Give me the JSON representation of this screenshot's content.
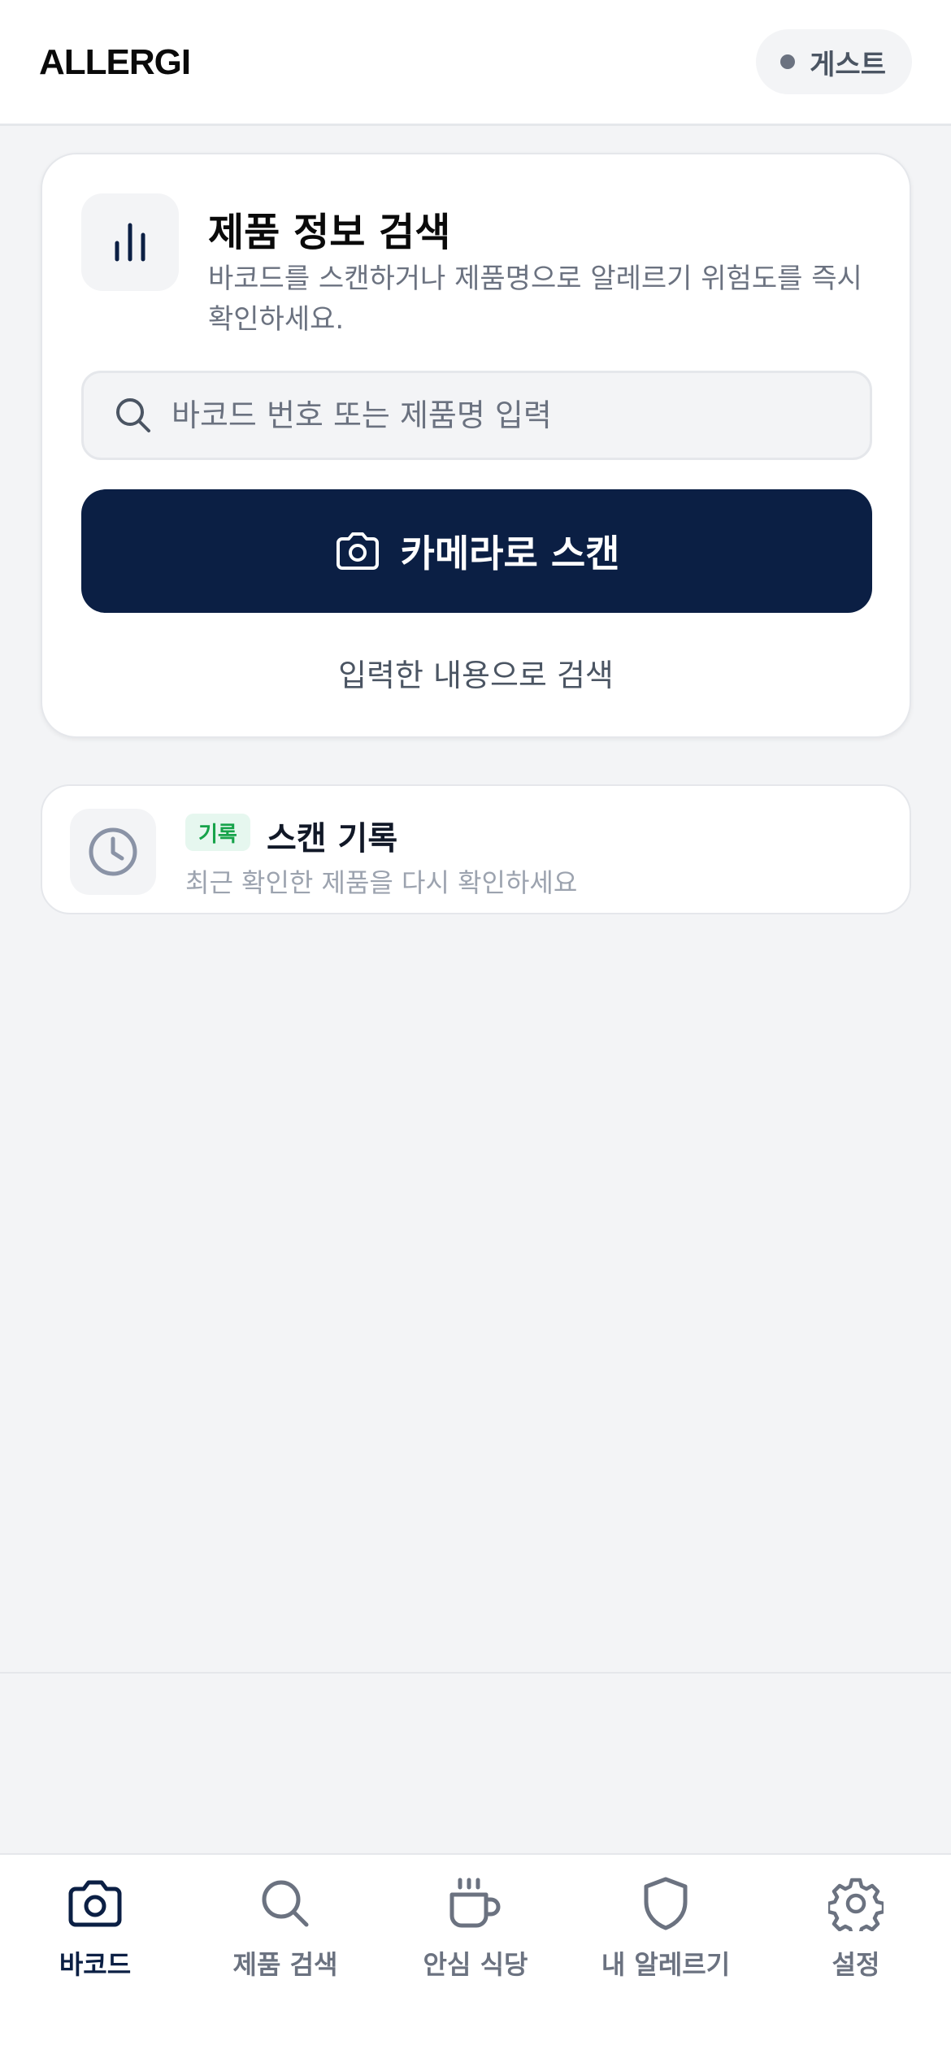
{
  "header": {
    "logo": "ALLERGI",
    "user_label": "게스트"
  },
  "search_card": {
    "icon": "bar-chart-icon",
    "title": "제품 정보 검색",
    "description": "바코드를 스캔하거나 제품명으로 알레르기 위험도를 즉시 확인하세요.",
    "input_value": "",
    "input_placeholder": "바코드 번호 또는 제품명 입력",
    "scan_button_label": "카메라로 스캔",
    "text_search_label": "입력한 내용으로 검색"
  },
  "history_card": {
    "icon": "clock-icon",
    "badge": "기록",
    "title": "스캔 기록",
    "subtitle": "최근 확인한 제품을 다시 확인하세요"
  },
  "bottom_nav": {
    "active": "barcode",
    "items": [
      {
        "id": "barcode",
        "label": "바코드",
        "icon": "camera-icon"
      },
      {
        "id": "product-search",
        "label": "제품 검색",
        "icon": "search-icon"
      },
      {
        "id": "safe-restaurant",
        "label": "안심 식당",
        "icon": "coffee-cup-icon"
      },
      {
        "id": "my-allergy",
        "label": "내 알레르기",
        "icon": "shield-icon"
      },
      {
        "id": "settings",
        "label": "설정",
        "icon": "gear-icon"
      }
    ]
  },
  "colors": {
    "primary": "#0b1f44",
    "background": "#f3f4f6",
    "badge_bg": "#e6f7ef",
    "badge_text": "#16a34a",
    "muted_text": "#6b7280"
  }
}
